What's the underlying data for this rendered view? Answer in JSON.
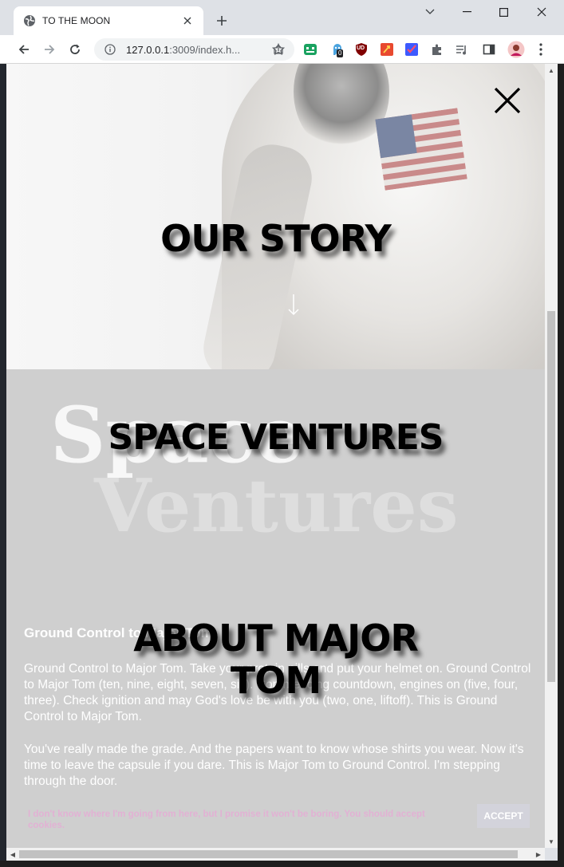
{
  "browser": {
    "tab_title": "TO THE MOON",
    "url_host": "127.0.0.1",
    "url_rest": ":3009/index.h...",
    "extension_badge": "0",
    "extension_ub": "UD"
  },
  "page": {
    "sections": [
      {
        "label": "OUR STORY"
      },
      {
        "label": "SPACE VENTURES"
      },
      {
        "label": "ABOUT MAJOR TOM"
      }
    ],
    "background_words": {
      "first": "Space",
      "second": "Ventures"
    },
    "copy": {
      "heading": "Ground Control to Major Tom",
      "paragraph1": "Ground Control to Major Tom. Take your protein pills and put your helmet on. Ground Control to Major Tom (ten, nine, eight, seven, six). Commencing countdown, engines on (five, four, three). Check ignition and may God's love be with you (two, one, liftoff). This is Ground Control to Major Tom.",
      "paragraph2": "You've really made the grade. And the papers want to know whose shirts you wear. Now it's time to leave the capsule if you dare. This is Major Tom to Ground Control. I'm stepping through the door."
    },
    "cookie": {
      "text": "I don't know where I'm going from here, but I promise it won't be boring. You should accept cookies.",
      "button": "ACCEPT"
    }
  },
  "colors": {
    "chrome_bg": "#dee1e6",
    "overlay_grey": "#cfcfcf",
    "cookie_text": "#e9a7d6",
    "accept_bg": "#d3d3db"
  }
}
